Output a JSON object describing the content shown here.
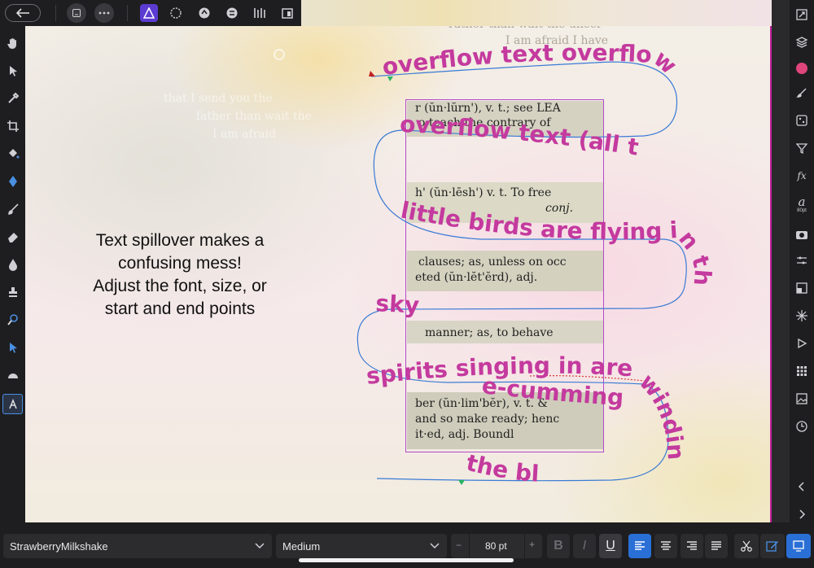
{
  "toolbar": {
    "back_label": "back",
    "personas": [
      "designer-persona",
      "pixel-persona",
      "export-persona",
      "settings-persona",
      "grid-persona",
      "layout-persona"
    ]
  },
  "left_tools": [
    "hand-tool",
    "move-tool",
    "color-picker-tool",
    "crop-tool",
    "fill-tool",
    "pen-tool",
    "brush-tool",
    "eraser-tool",
    "blur-tool",
    "stamp-tool",
    "dodge-tool",
    "selection-tool",
    "shape-tool",
    "text-tool"
  ],
  "right_studio": {
    "items": [
      "canvas-size",
      "layers",
      "color",
      "brushes",
      "swatches",
      "adjustments",
      "fx",
      "character",
      "stock",
      "transform",
      "navigator",
      "effects",
      "play",
      "grid",
      "photos",
      "history",
      "chevron-left",
      "chevron-right"
    ],
    "character_size": "80pt",
    "color_hex": "#e0457b"
  },
  "canvas": {
    "note": "Text spillover makes a\nconfusing mess!\nAdjust the font, size, or\nstart and end points",
    "path_text": {
      "line1": "overflow text overflow",
      "line2": "overflow text (all the merry",
      "line3": "little birds are flying in the floating in the",
      "line4": "sky",
      "line5": "spirits singing in are winding in",
      "line6": "e-cumming",
      "line7": "the blossoming in"
    },
    "dictionary": {
      "r1": "r (ŭn·lŭrn'), v. t.; see LEA",
      "r2": "o teach the contrary of",
      "r3": "h' (ŭn·lēsh') v. t.  To free",
      "r4": "conj.",
      "r5": "clauses; as, unless on occ",
      "r6": "eted (ŭn·lĕt'ĕrd), adj.",
      "r7": "manner; as, to behave",
      "r8": "ber (ŭn·lim'bĕr), v. t. &",
      "r9": "and so make ready; henc",
      "r10": "it·ed, adj.   Boundl"
    },
    "bg_words": {
      "w1": "father than wait the",
      "w2": "I am afraid",
      "w3": "that I send you the",
      "w4": "rather than wait the uncer",
      "w5": "I am afraid I have"
    },
    "text_color": "#c43a9e",
    "frame_color": "#b14bc9",
    "path_color": "#3a7bd5"
  },
  "bottom": {
    "font_family": "StrawberryMilkshake",
    "font_weight": "Medium",
    "font_size": "80 pt",
    "minus": "−",
    "plus": "+",
    "bold": "B",
    "italic": "I",
    "underline": "U"
  }
}
